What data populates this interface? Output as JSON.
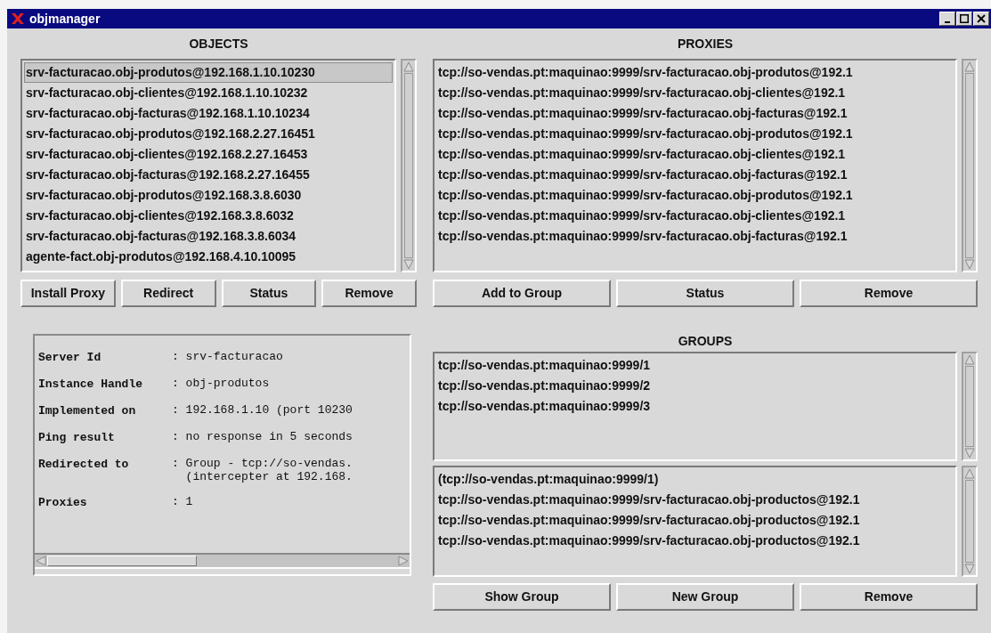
{
  "window": {
    "title": "objmanager"
  },
  "objects": {
    "title": "OBJECTS",
    "items": [
      {
        "label": "srv-facturacao.obj-produtos@192.168.1.10.10230",
        "selected": true
      },
      {
        "label": "srv-facturacao.obj-clientes@192.168.1.10.10232",
        "selected": false
      },
      {
        "label": "srv-facturacao.obj-facturas@192.168.1.10.10234",
        "selected": false
      },
      {
        "label": "srv-facturacao.obj-produtos@192.168.2.27.16451",
        "selected": false
      },
      {
        "label": "srv-facturacao.obj-clientes@192.168.2.27.16453",
        "selected": false
      },
      {
        "label": "srv-facturacao.obj-facturas@192.168.2.27.16455",
        "selected": false
      },
      {
        "label": "srv-facturacao.obj-produtos@192.168.3.8.6030",
        "selected": false
      },
      {
        "label": "srv-facturacao.obj-clientes@192.168.3.8.6032",
        "selected": false
      },
      {
        "label": "srv-facturacao.obj-facturas@192.168.3.8.6034",
        "selected": false
      },
      {
        "label": "agente-fact.obj-produtos@192.168.4.10.10095",
        "selected": false
      }
    ],
    "buttons": [
      "Install Proxy",
      "Redirect",
      "Status",
      "Remove"
    ]
  },
  "proxies": {
    "title": "PROXIES",
    "items": [
      "tcp://so-vendas.pt:maquinao:9999/srv-facturacao.obj-produtos@192.1",
      "tcp://so-vendas.pt:maquinao:9999/srv-facturacao.obj-clientes@192.1",
      "tcp://so-vendas.pt:maquinao:9999/srv-facturacao.obj-facturas@192.1",
      "tcp://so-vendas.pt:maquinao:9999/srv-facturacao.obj-produtos@192.1",
      "tcp://so-vendas.pt:maquinao:9999/srv-facturacao.obj-clientes@192.1",
      "tcp://so-vendas.pt:maquinao:9999/srv-facturacao.obj-facturas@192.1",
      "tcp://so-vendas.pt:maquinao:9999/srv-facturacao.obj-produtos@192.1",
      "tcp://so-vendas.pt:maquinao:9999/srv-facturacao.obj-clientes@192.1",
      "tcp://so-vendas.pt:maquinao:9999/srv-facturacao.obj-facturas@192.1"
    ],
    "buttons": [
      "Add to Group",
      "Status",
      "Remove"
    ]
  },
  "details": [
    {
      "label": "Server Id",
      "value": [
        ": srv-facturacao"
      ]
    },
    {
      "label": "Instance Handle",
      "value": [
        ": obj-produtos"
      ]
    },
    {
      "label": "Implemented on",
      "value": [
        ": 192.168.1.10 (port 10230"
      ]
    },
    {
      "label": "Ping result",
      "value": [
        ": no response in 5 seconds"
      ]
    },
    {
      "label": "Redirected to",
      "value": [
        ": Group - tcp://so-vendas.",
        "  (intercepter at 192.168."
      ]
    },
    {
      "label": "Proxies",
      "value": [
        ": 1"
      ]
    }
  ],
  "groups": {
    "title": "GROUPS",
    "items": [
      "tcp://so-vendas.pt:maquinao:9999/1",
      "tcp://so-vendas.pt:maquinao:9999/2",
      "tcp://so-vendas.pt:maquinao:9999/3"
    ],
    "members": [
      "(tcp://so-vendas.pt:maquinao:9999/1)",
      "tcp://so-vendas.pt:maquinao:9999/srv-facturacao.obj-productos@192.1",
      "tcp://so-vendas.pt:maquinao:9999/srv-facturacao.obj-productos@192.1",
      "tcp://so-vendas.pt:maquinao:9999/srv-facturacao.obj-productos@192.1"
    ],
    "buttons": [
      "Show Group",
      "New Group",
      "Remove"
    ]
  }
}
